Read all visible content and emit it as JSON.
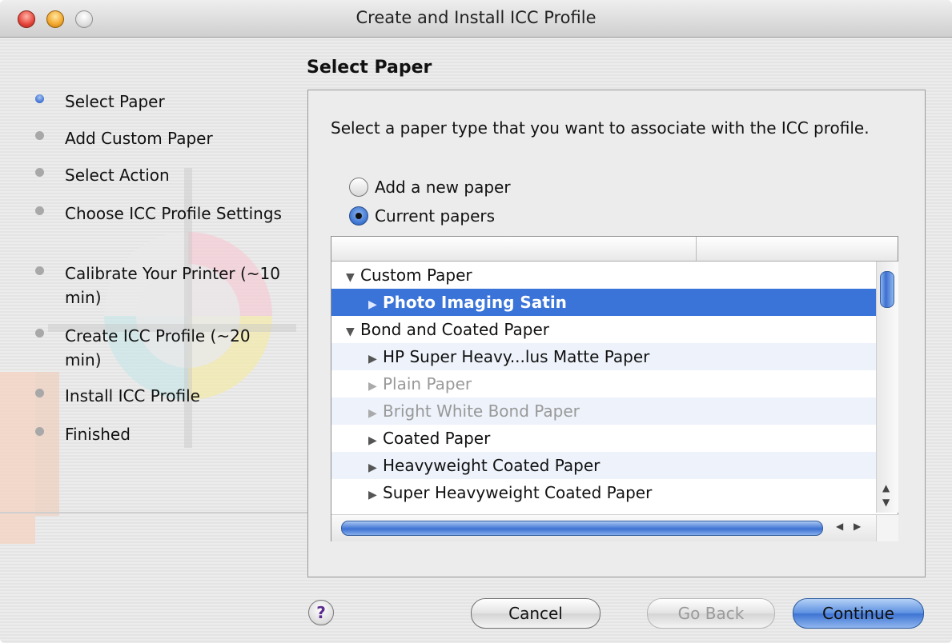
{
  "window": {
    "title": "Create and Install ICC Profile"
  },
  "steps": [
    {
      "label": "Select Paper",
      "active": true
    },
    {
      "label": "Add Custom Paper"
    },
    {
      "label": "Select Action"
    },
    {
      "label": "Choose ICC Profile Settings"
    },
    {
      "label": "Calibrate Your Printer (~10 min)"
    },
    {
      "label": "Create ICC Profile (~20 min)"
    },
    {
      "label": "Install ICC Profile"
    },
    {
      "label": "Finished"
    }
  ],
  "main": {
    "section_title": "Select Paper",
    "instructions": "Select a paper type that you want to associate with the ICC profile.",
    "radios": [
      {
        "label": "Add a new paper",
        "checked": false
      },
      {
        "label": "Current papers",
        "checked": true
      }
    ],
    "paper_list": [
      {
        "label": "Custom Paper",
        "expanded": true,
        "level": 0
      },
      {
        "label": "Photo Imaging Satin",
        "level": 1,
        "selected": true
      },
      {
        "label": "Bond and Coated Paper",
        "expanded": true,
        "level": 0
      },
      {
        "label": "HP Super Heavy...lus Matte Paper",
        "level": 1
      },
      {
        "label": "Plain Paper",
        "level": 1,
        "disabled": true
      },
      {
        "label": "Bright White Bond Paper",
        "level": 1,
        "disabled": true
      },
      {
        "label": "Coated Paper",
        "level": 1
      },
      {
        "label": "Heavyweight Coated Paper",
        "level": 1
      },
      {
        "label": "Super Heavyweight Coated Paper",
        "level": 1
      }
    ]
  },
  "buttons": {
    "help": "?",
    "cancel": "Cancel",
    "go_back": "Go Back",
    "continue": "Continue"
  },
  "colors": {
    "selection": "#3a74d8",
    "accent": "#3c73d2"
  }
}
